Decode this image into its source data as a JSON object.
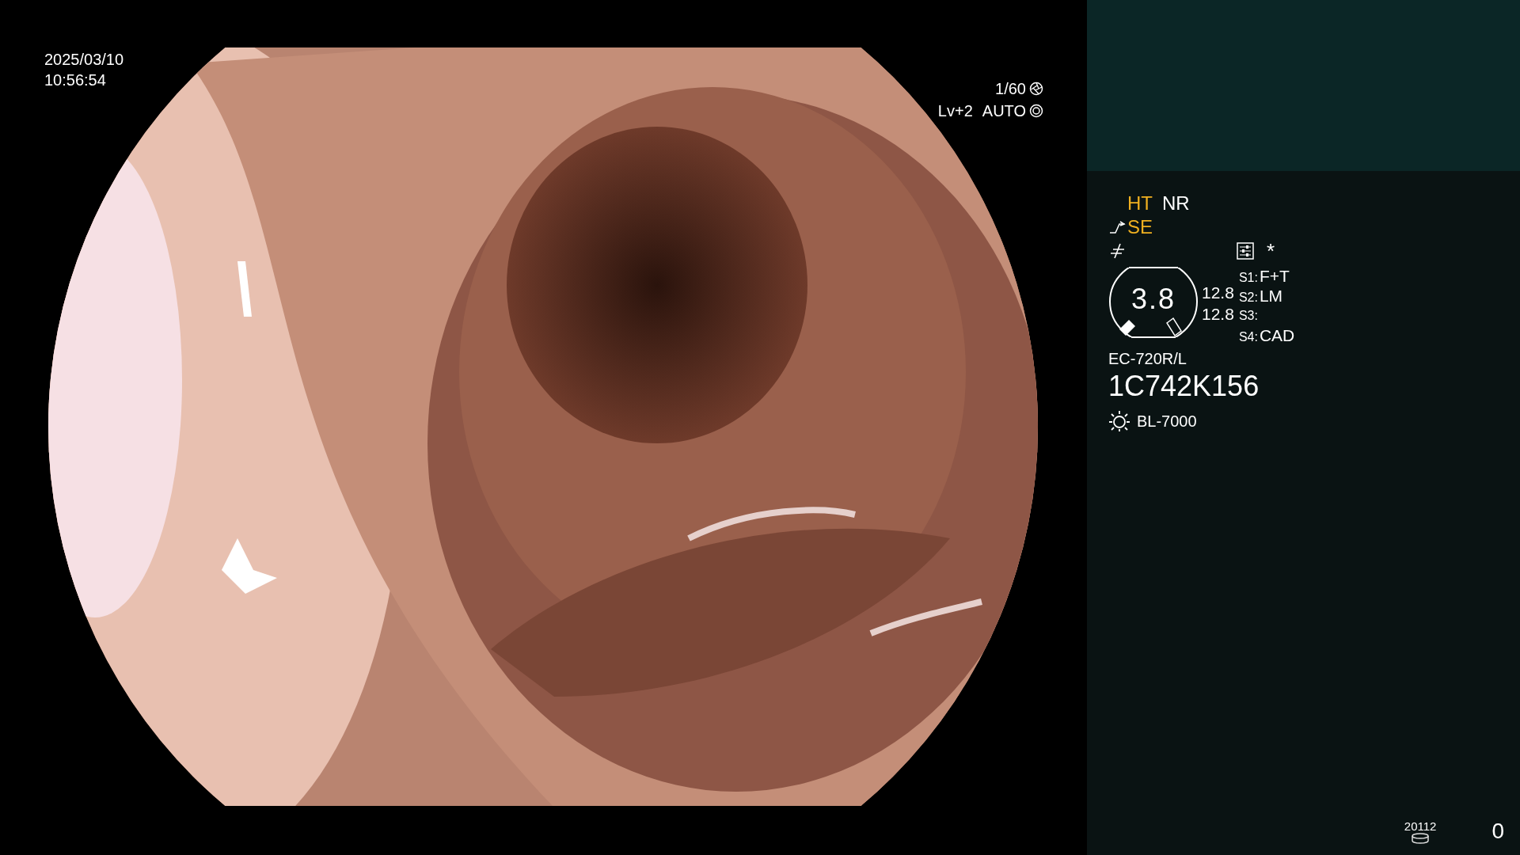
{
  "datetime": {
    "date": "2025/03/10",
    "time": "10:56:54"
  },
  "exposure": {
    "shutter": "1/60",
    "brightness": "Lv+2",
    "mode": "AUTO"
  },
  "image_modes": [
    {
      "label": "HT",
      "active": true
    },
    {
      "label": "NR",
      "active": false
    }
  ],
  "enhancement": {
    "label": "SE",
    "active": true
  },
  "asterisk": "*",
  "zoom": {
    "value": "3.8",
    "readings": [
      "12.8",
      "12.8"
    ]
  },
  "scope_switches": [
    {
      "key": "S1:",
      "function": "F+T"
    },
    {
      "key": "S2:",
      "function": "LM"
    },
    {
      "key": "S3:"
    },
    {
      "key": "S4:",
      "function": "CAD"
    }
  ],
  "scope_model": "EC-720R/L",
  "serial": "1C742K156",
  "light_source": "BL-7000",
  "storage": {
    "count": "20112"
  },
  "counter": "0"
}
